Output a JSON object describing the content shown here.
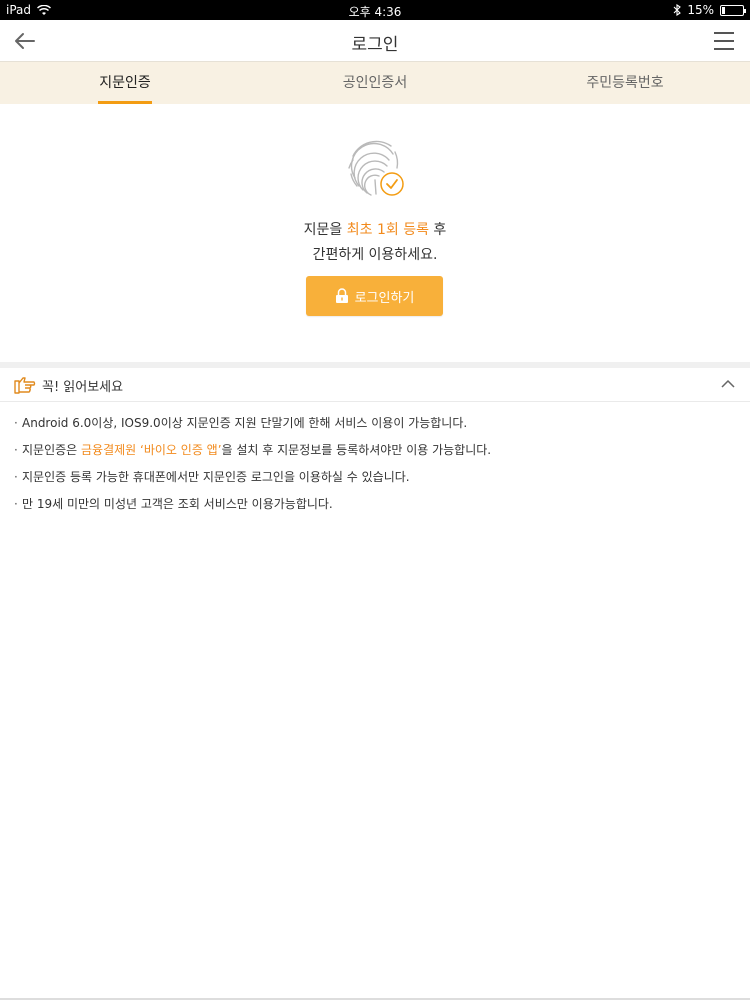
{
  "status_bar": {
    "device": "iPad",
    "time": "오후 4:36",
    "battery": "15%",
    "battery_level": 0.15
  },
  "header": {
    "title": "로그인"
  },
  "tabs": [
    {
      "label": "지문인증",
      "active": true
    },
    {
      "label": "공인인증서",
      "active": false
    },
    {
      "label": "주민등록번호",
      "active": false
    }
  ],
  "main": {
    "message_line1_pre": "지문을 ",
    "message_line1_highlight": "최초 1회 등록",
    "message_line1_post": " 후",
    "message_line2": "간편하게 이용하세요.",
    "login_button": "로그인하기"
  },
  "notice": {
    "title": "꼭! 읽어보세요",
    "items": [
      {
        "pre": "Android 6.0이상, IOS9.0이상 지문인증 지원 단말기에 한해 서비스 이용이 가능합니다.",
        "highlight": "",
        "post": ""
      },
      {
        "pre": "지문인증은 ",
        "highlight": "금융결제원 ‘바이오 인증 앱’",
        "post": "을 설치 후 지문정보를 등록하셔야만 이용 가능합니다."
      },
      {
        "pre": "지문인증 등록 가능한 휴대폰에서만 지문인증 로그인을 이용하실 수 있습니다.",
        "highlight": "",
        "post": ""
      },
      {
        "pre": "만 19세 미만의 미성년 고객은 조회 서비스만 이용가능합니다.",
        "highlight": "",
        "post": ""
      }
    ]
  },
  "colors": {
    "accent": "#f28a1c",
    "button": "#f8b03a",
    "tab_bg": "#f8f1e3"
  },
  "icons": {
    "back": "arrow-left-icon",
    "menu": "hamburger-icon",
    "fingerprint": "fingerprint-icon",
    "lock": "lock-icon",
    "hand": "pointing-hand-icon",
    "chevron": "chevron-up-icon",
    "wifi": "wifi-icon",
    "bluetooth": "bluetooth-icon",
    "battery": "battery-icon"
  }
}
